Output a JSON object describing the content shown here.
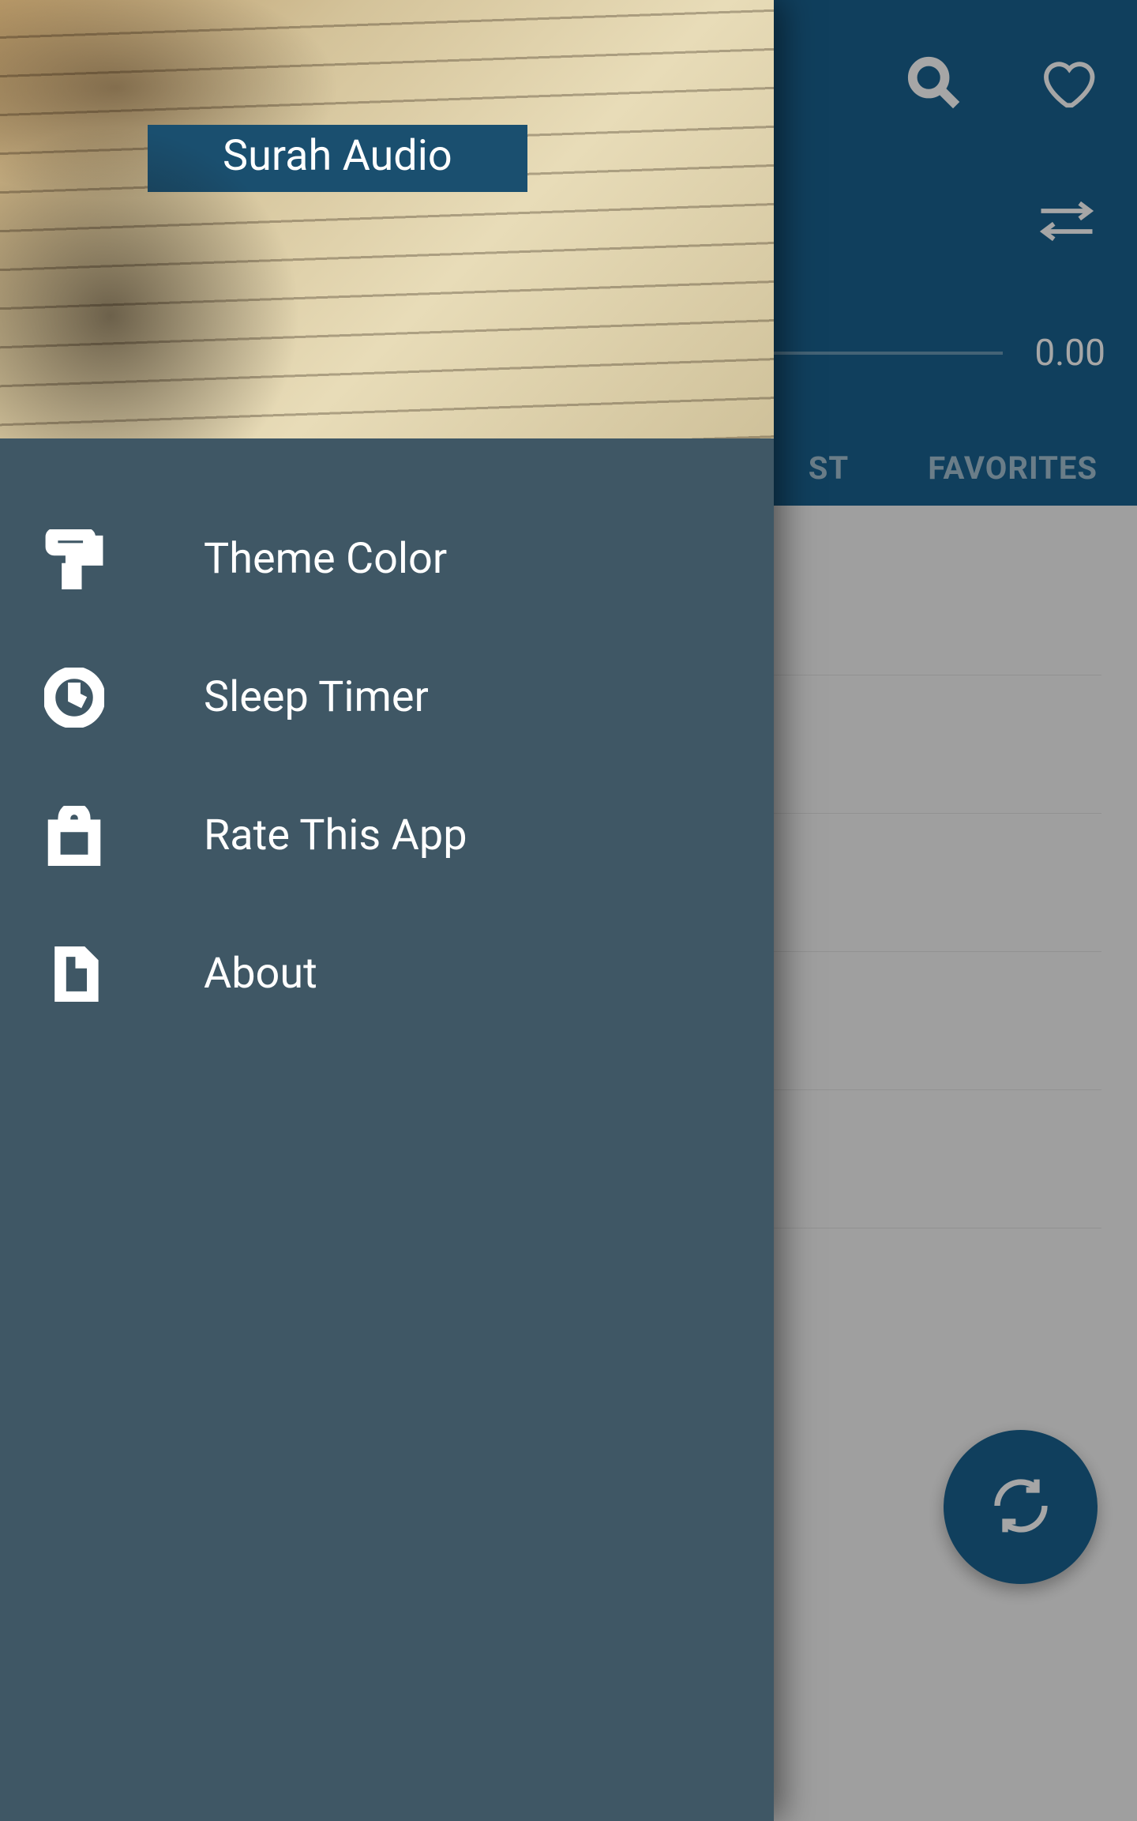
{
  "drawer": {
    "title": "Surah Audio",
    "items": [
      {
        "label": "Theme Color",
        "icon": "paint-roller"
      },
      {
        "label": "Sleep Timer",
        "icon": "clock"
      },
      {
        "label": "Rate This App",
        "icon": "shopping-bag"
      },
      {
        "label": "About",
        "icon": "file"
      }
    ]
  },
  "background": {
    "tabs": {
      "visible_partial": "ST",
      "favorites_label": "FAVORITES"
    },
    "time_right": "0.00"
  }
}
